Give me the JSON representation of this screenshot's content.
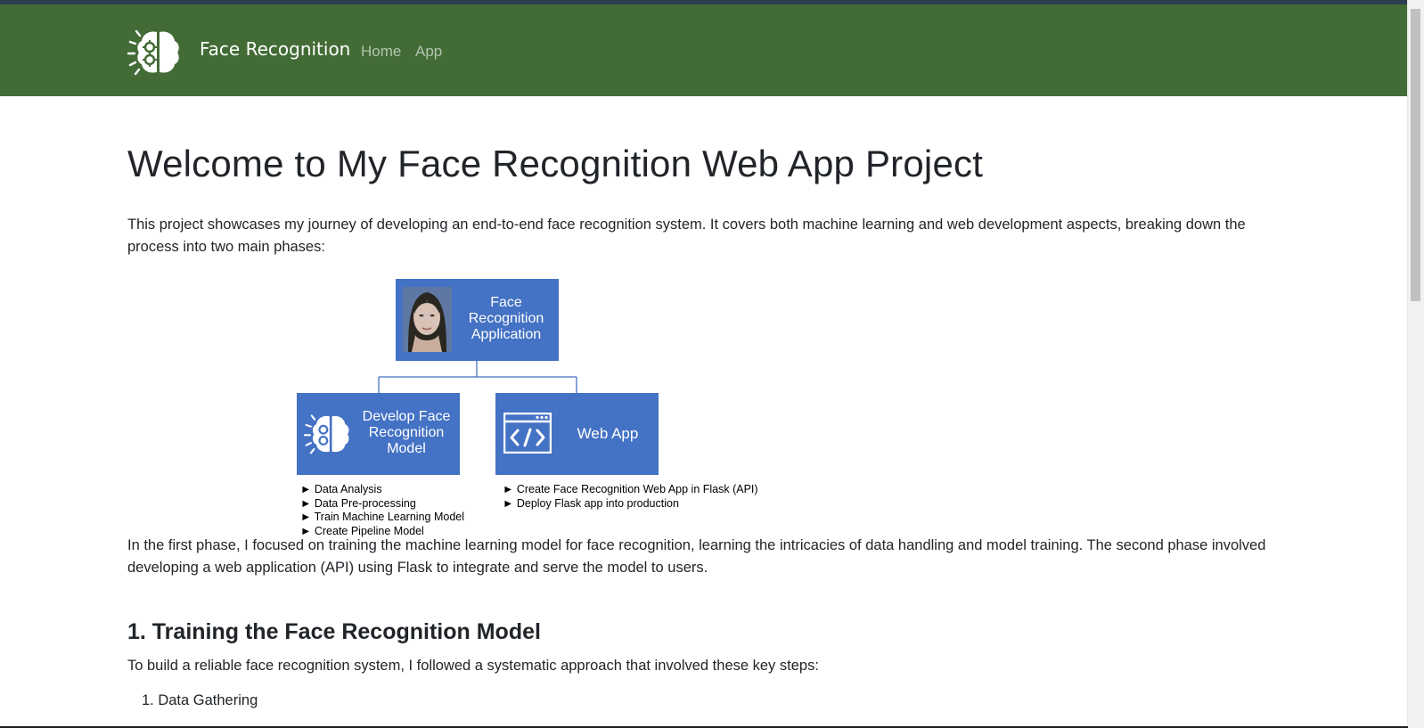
{
  "navbar": {
    "brand": "Face Recognition",
    "links": [
      "Home",
      "App"
    ]
  },
  "main": {
    "title": "Welcome to My Face Recognition Web App Project",
    "intro": "This project showcases my journey of developing an end-to-end face recognition system. It covers both machine learning and web development aspects, breaking down the process into two main phases:",
    "diagram": {
      "root": "Face Recognition Application",
      "left": {
        "title": "Develop Face Recognition Model",
        "bullets": [
          "► Data Analysis",
          "► Data Pre-processing",
          "► Train Machine Learning Model",
          "►  Create Pipeline Model"
        ]
      },
      "right": {
        "title": "Web App",
        "bullets": [
          "► Create Face Recognition Web App in Flask (API)",
          "► Deploy Flask app into production"
        ]
      }
    },
    "phases": "In the first phase, I focused on training the machine learning model for face recognition, learning the intricacies of data handling and model training. The second phase involved developing a web application (API) using Flask to integrate and serve the model to users.",
    "section_heading": "1. Training the Face Recognition Model",
    "section_intro": "To build a reliable face recognition system, I followed a systematic approach that involved these key steps:",
    "steps": [
      "1. Data Gathering"
    ]
  },
  "colors": {
    "navbar": "#436b36",
    "diagram_box": "#4472c4"
  }
}
